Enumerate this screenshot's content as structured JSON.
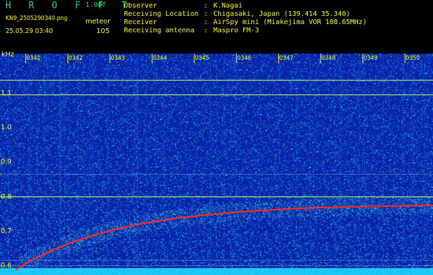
{
  "header": {
    "app_logo": "H R O F F T",
    "app_version": "1.00f",
    "file_name": "KN9_2505290340.png",
    "mode": "meteor",
    "datetime": "25.05.29 03:40",
    "count": "105"
  },
  "info": [
    {
      "label": "Observer",
      "value": "K.Nagai"
    },
    {
      "label": "Receiving Location",
      "value": "Chigasaki, Japan (139.414 35.340)"
    },
    {
      "label": "Receiver",
      "value": "AirSpy mini (Miakejima VOR 108.65MHz)"
    },
    {
      "label": "Receiving antenna",
      "value": "Maspro FM-3"
    }
  ],
  "colors": {
    "label_text": "#ffff00",
    "logo_text": "#22e07a",
    "background": "#000000",
    "spectrogram_base": "#0a2aa8",
    "trace": "#ff2a1e",
    "carrier_line": "#a8e070",
    "floor_band": "#20e0ff"
  },
  "chart_data": {
    "type": "heatmap",
    "ylabel": "kHz",
    "yticks": [
      "1.1",
      "1.0",
      "0.9",
      "0.8",
      "0.7",
      "0.6"
    ],
    "ytick_values": [
      1.1,
      1.0,
      0.9,
      0.8,
      0.7,
      0.6
    ],
    "xticks": [
      "0341",
      "0342",
      "0343",
      "0344",
      "0345",
      "0346",
      "0347",
      "0348",
      "0349",
      "0350"
    ],
    "xtick_minutes": [
      41,
      42,
      43,
      44,
      45,
      46,
      47,
      48,
      49,
      50
    ],
    "xlim": [
      40.7,
      50.6
    ],
    "ylim": [
      0.575,
      1.215
    ],
    "horizontal_lines": [
      {
        "freq": 1.138,
        "kind": "strong"
      },
      {
        "freq": 1.096,
        "kind": "strong"
      },
      {
        "freq": 0.866,
        "kind": "faint"
      },
      {
        "freq": 0.801,
        "kind": "strong"
      },
      {
        "freq": 0.618,
        "kind": "faint"
      },
      {
        "freq": 0.602,
        "kind": "faint"
      }
    ],
    "trace": {
      "name": "",
      "x": [
        40.7,
        41.0,
        41.5,
        42.0,
        42.5,
        43.0,
        43.5,
        44.0,
        44.5,
        45.0,
        45.5,
        46.0,
        46.5,
        47.0,
        47.5,
        48.0,
        48.5,
        49.0,
        49.5,
        50.0,
        50.6
      ],
      "y": [
        0.59,
        0.613,
        0.643,
        0.668,
        0.688,
        0.705,
        0.719,
        0.73,
        0.739,
        0.746,
        0.752,
        0.757,
        0.761,
        0.765,
        0.768,
        0.77,
        0.772,
        0.773,
        0.774,
        0.775,
        0.776
      ]
    }
  }
}
